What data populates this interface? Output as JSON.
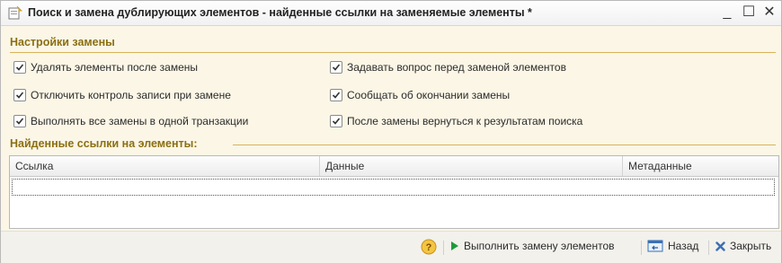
{
  "window": {
    "title": "Поиск и замена дублирующих элементов - найденные ссылки на заменяемые элементы *",
    "minimize_label": "_",
    "maximize_label": "☐",
    "close_label": "✕"
  },
  "settings": {
    "title": "Настройки замены",
    "options": [
      {
        "label": "Удалять элементы после замены",
        "checked": true
      },
      {
        "label": "Отключить контроль записи при замене",
        "checked": true
      },
      {
        "label": "Выполнять все замены в одной транзакции",
        "checked": true
      },
      {
        "label": "Задавать вопрос перед заменой элементов",
        "checked": true
      },
      {
        "label": "Сообщать об окончании замены",
        "checked": true
      },
      {
        "label": "После замены вернуться к результатам поиска",
        "checked": true
      }
    ]
  },
  "references": {
    "title": "Найденные ссылки на элементы:",
    "columns": [
      "Ссылка",
      "Данные",
      "Метаданные"
    ],
    "rows": []
  },
  "toolbar": {
    "help_label": "?",
    "execute_label": "Выполнить замену элементов",
    "back_label": "Назад",
    "close_label": "Закрыть"
  },
  "colors": {
    "accent": "#8b6f12",
    "separator": "#d6b45b",
    "background": "#fbf6e6",
    "execute_arrow": "#1e9b3a",
    "close_x": "#3a6fb5"
  }
}
